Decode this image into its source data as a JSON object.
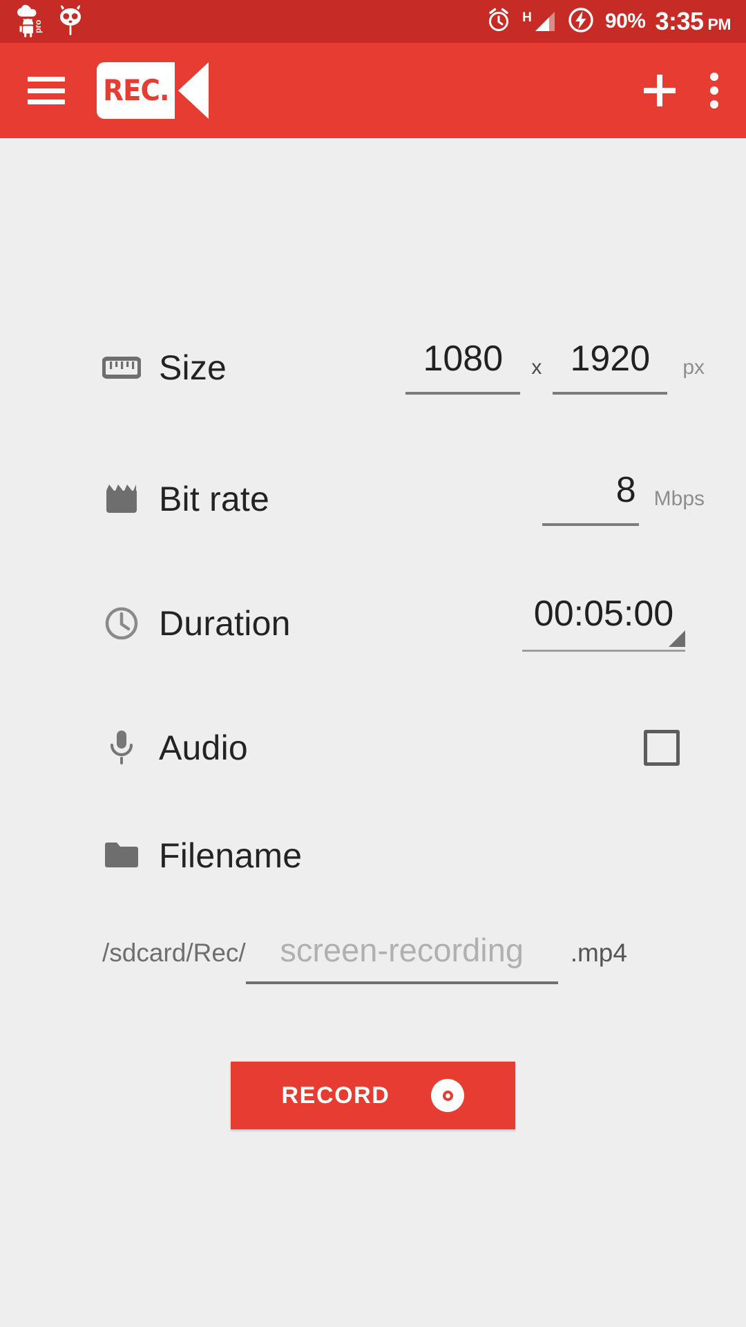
{
  "statusbar": {
    "background": "#c62b25",
    "left_icons": [
      {
        "name": "cloud-android-pro-icon",
        "label": "pro"
      },
      {
        "name": "cyanogenmod-icon",
        "label": "CyanogenMod"
      }
    ],
    "alarm_icon": "alarm-clock-icon",
    "network_type": "H",
    "signal_icon": "signal-bars-icon",
    "charging_icon": "charging-bolt-icon",
    "battery": "90%",
    "time": "3:35",
    "ampm": "PM"
  },
  "appbar": {
    "background": "#e73c32",
    "menu_icon": "hamburger-menu-icon",
    "logo_text": "REC.",
    "logo_lens_icon": "camera-lens-icon",
    "add_icon": "plus-icon",
    "overflow_icon": "overflow-menu-icon"
  },
  "settings": {
    "size": {
      "icon": "ruler-icon",
      "label": "Size",
      "width": "1080",
      "separator": "x",
      "height": "1920",
      "unit": "px"
    },
    "bitrate": {
      "icon": "clapperboard-icon",
      "label": "Bit rate",
      "value": "8",
      "unit": "Mbps"
    },
    "duration": {
      "icon": "clock-icon",
      "label": "Duration",
      "value": "00:05:00"
    },
    "audio": {
      "icon": "microphone-icon",
      "label": "Audio",
      "checked": false
    },
    "filename": {
      "icon": "folder-icon",
      "label": "Filename",
      "prefix": "/sdcard/Rec/",
      "value": "",
      "placeholder": "screen-recording",
      "suffix": ".mp4"
    }
  },
  "record_button": {
    "label": "RECORD",
    "icon": "record-dot-icon",
    "color": "#e73c32"
  }
}
